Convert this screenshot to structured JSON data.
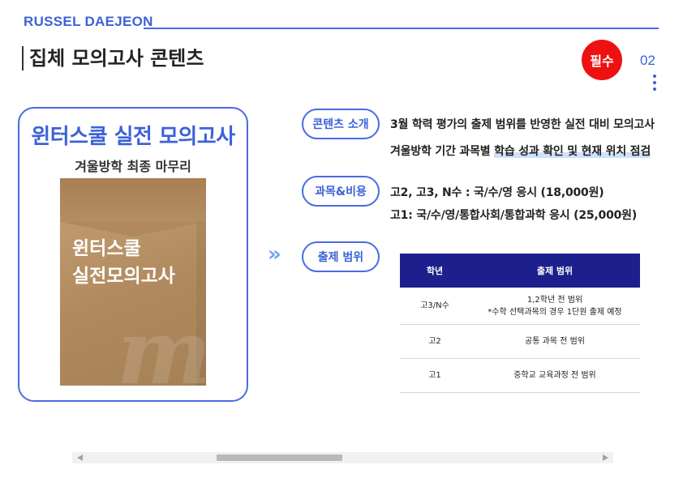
{
  "header": {
    "brand": "RUSSEL DAEJEON",
    "title": "집체 모의고사 콘텐츠",
    "badge": "필수",
    "page_number": "02"
  },
  "card": {
    "title": "윈터스쿨 실전 모의고사",
    "subtitle": "겨울방학 최종 마무리",
    "envelope_line1": "윈터스쿨",
    "envelope_line2": "실전모의고사"
  },
  "sections": {
    "intro": {
      "label": "콘텐츠 소개",
      "line1": "3월 학력 평가의 출제 범위를 반영한 실전 대비 모의고사",
      "line2_plain": "겨울방학 기간 과목별 ",
      "line2_highlight": "학습 성과 확인 및 현재 위치 점검"
    },
    "subjects": {
      "label": "과목&비용",
      "line1": "고2, 고3, N수 : 국/수/영 응시 (18,000원)",
      "line2": "고1: 국/수/영/통합사회/통합과학 응시 (25,000원)"
    },
    "scope": {
      "label": "출제 범위"
    }
  },
  "table": {
    "headers": [
      "학년",
      "출제 범위"
    ],
    "rows": [
      {
        "grade": "고3/N수",
        "scope": "1,2학년 전 범위",
        "note": "*수학 선택과목의 경우 1단원 출제 예정"
      },
      {
        "grade": "고2",
        "scope": "공통 과목 전 범위",
        "note": ""
      },
      {
        "grade": "고1",
        "scope": "중학교 교육과정 전 범위",
        "note": ""
      }
    ]
  },
  "colors": {
    "accent": "#3d62d8",
    "badge": "#ee1111",
    "table_header": "#1c1f8c"
  }
}
